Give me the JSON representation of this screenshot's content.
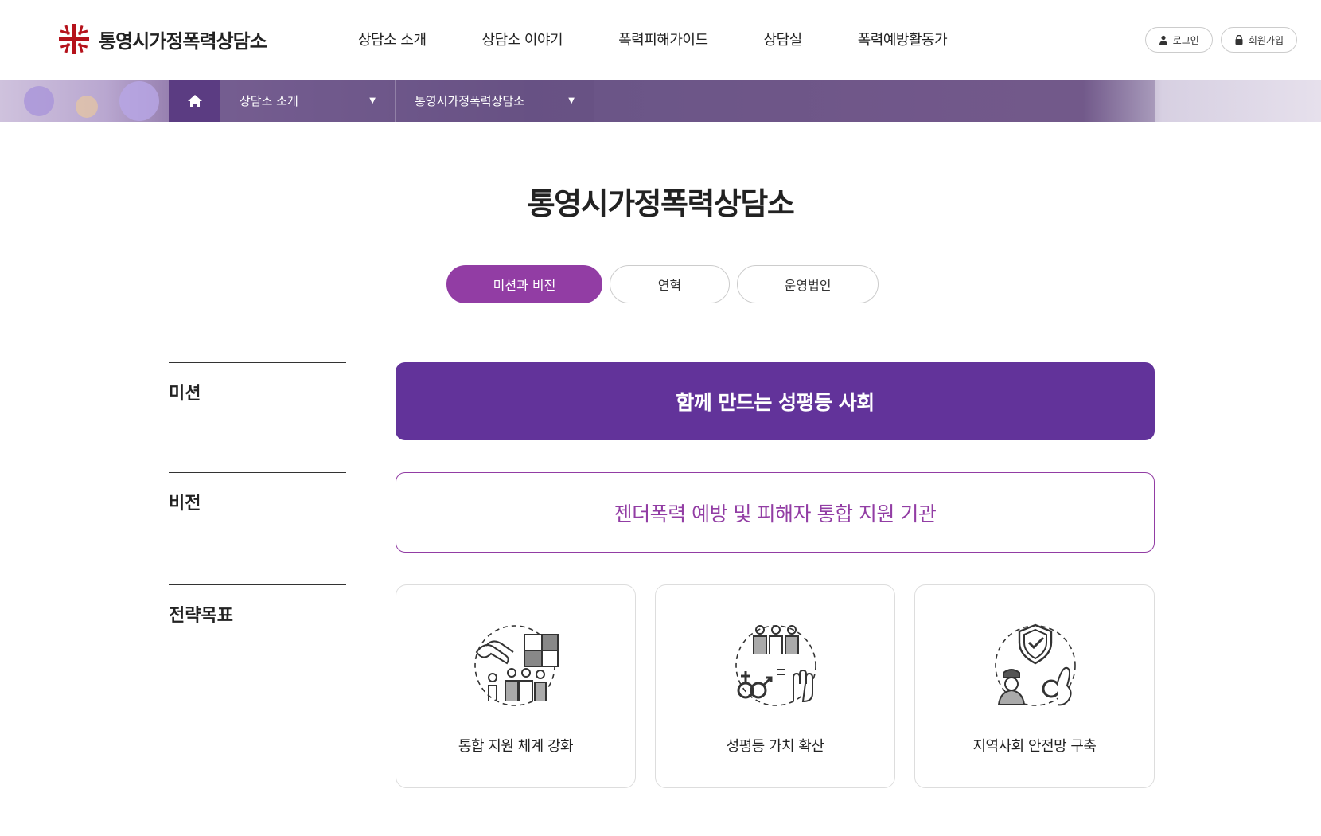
{
  "brand": {
    "name": "통영시가정폭력상담소",
    "accent": "#923da4",
    "deep": "#62339a",
    "logo_red": "#b5121b"
  },
  "nav": [
    "상담소 소개",
    "상담소 이야기",
    "폭력피해가이드",
    "상담실",
    "폭력예방활동가"
  ],
  "util": {
    "login": "로그인",
    "join": "회원가입"
  },
  "breadcrumb": {
    "home_icon": "home-icon",
    "level1": "상담소 소개",
    "level2": "통영시가정폭력상담소"
  },
  "page": {
    "title": "통영시가정폭력상담소"
  },
  "tabs": [
    {
      "label": "미션과 비전",
      "active": true
    },
    {
      "label": "연혁",
      "active": false
    },
    {
      "label": "운영법인",
      "active": false
    }
  ],
  "sections": {
    "mission": {
      "label": "미션",
      "text": "함께 만드는 성평등 사회"
    },
    "vision": {
      "label": "비전",
      "text": "젠더폭력 예방 및 피해자 통합 지원 기관"
    },
    "goals": {
      "label": "전략목표",
      "items": [
        {
          "icon": "collaboration-puzzle-icon",
          "caption": "통합 지원 체계 강화"
        },
        {
          "icon": "gender-equality-icon",
          "caption": "성평등 가치 확산"
        },
        {
          "icon": "safety-shield-icon",
          "caption": "지역사회 안전망 구축"
        }
      ]
    }
  }
}
